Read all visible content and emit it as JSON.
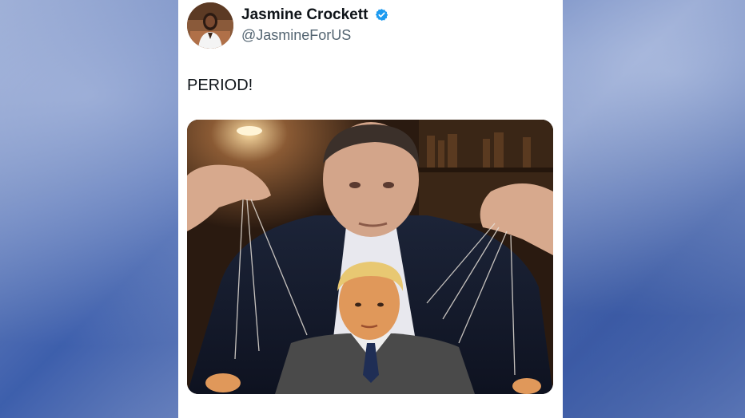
{
  "tweet": {
    "display_name": "Jasmine Crockett",
    "handle": "@JasmineForUS",
    "text": "PERIOD!",
    "verified": true,
    "avatar_icon": "profile-photo",
    "verified_icon": "verified-badge-icon",
    "media_description_icon": "attached-image"
  },
  "colors": {
    "verified": "#1d9bf0",
    "text": "#0f1419",
    "secondary_text": "#536471",
    "card_background": "#ffffff"
  }
}
